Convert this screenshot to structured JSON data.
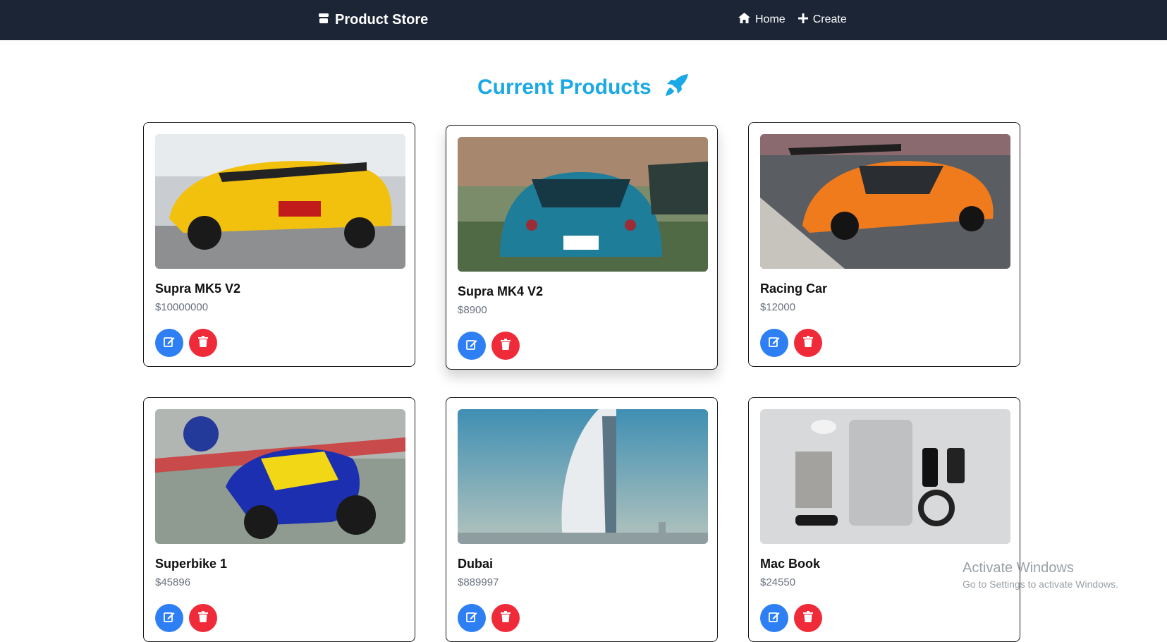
{
  "navbar": {
    "brand": "Product Store",
    "links": [
      {
        "label": "Home",
        "icon": "home-icon"
      },
      {
        "label": "Create",
        "icon": "plus-icon"
      }
    ]
  },
  "page": {
    "title": "Current Products",
    "title_color": "#1aa8e6"
  },
  "products": [
    {
      "name": "Supra MK5 V2",
      "price": "$10000000"
    },
    {
      "name": "Supra MK4 V2",
      "price": "$8900"
    },
    {
      "name": "Racing Car",
      "price": "$12000"
    },
    {
      "name": "Superbike 1",
      "price": "$45896"
    },
    {
      "name": "Dubai",
      "price": "$889997"
    },
    {
      "name": "Mac Book",
      "price": "$24550"
    }
  ],
  "colors": {
    "navbar": "#1b2535",
    "edit": "#2f7ff4",
    "delete": "#ef2b39"
  },
  "watermark": {
    "title": "Activate Windows",
    "subtitle": "Go to Settings to activate Windows."
  }
}
